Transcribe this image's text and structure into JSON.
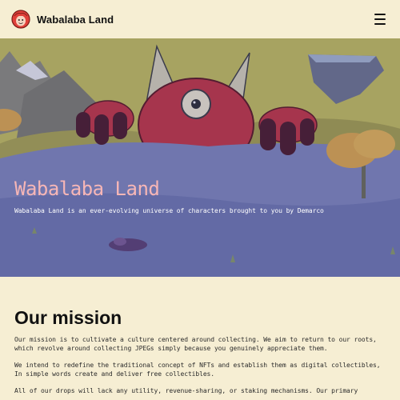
{
  "nav": {
    "brand": "Wabalaba Land",
    "logo_icon": "red-monster-logo-icon",
    "menu_icon": "hamburger-menu-icon"
  },
  "hero": {
    "title": "Wabalaba Land",
    "subtitle": "Wabalaba Land is an ever-evolving universe of characters brought to you by Demarco",
    "title_color": "#f6b6b6",
    "overlay_color": "#3b3f8f"
  },
  "mission": {
    "heading": "Our mission",
    "paragraphs": [
      "Our mission is to cultivate a culture centered around collecting. We aim to return to our roots, which revolve around collecting JPEGs simply because you genuinely appreciate them.",
      "We intend to redefine the traditional concept of NFTs and establish them as digital collectibles, In simple words create and deliver free collectibles.",
      "All of our drops will lack any utility, revenue-sharing, or staking mechanisms. Our primary"
    ]
  },
  "colors": {
    "background": "#f6eed3",
    "accent": "#f6b6b6"
  }
}
